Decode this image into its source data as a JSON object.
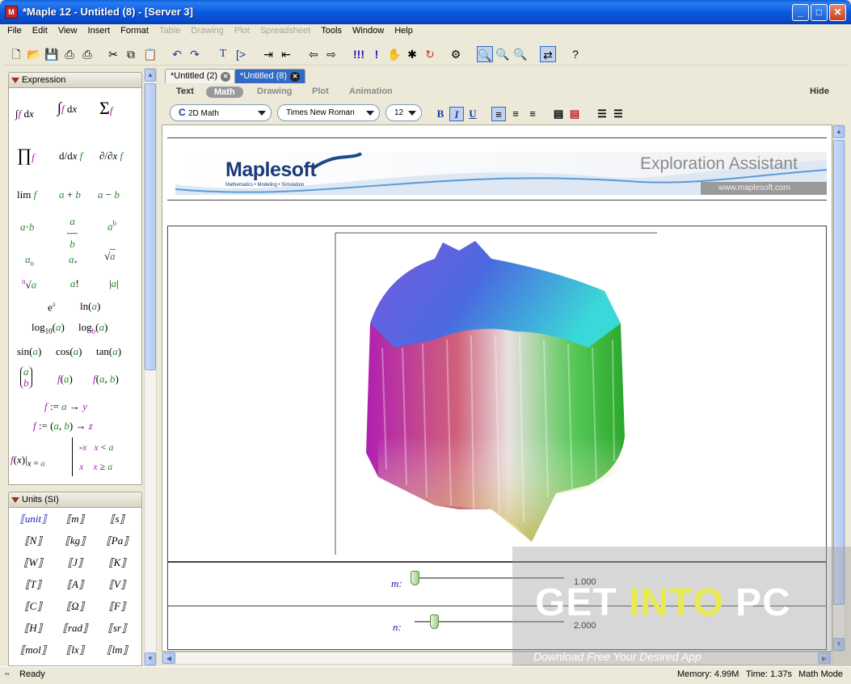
{
  "window": {
    "title": "*Maple 12 - Untitled (8) - [Server 3]",
    "app_icon": "maple-leaf-icon"
  },
  "menu": [
    {
      "label": "File",
      "enabled": true
    },
    {
      "label": "Edit",
      "enabled": true
    },
    {
      "label": "View",
      "enabled": true
    },
    {
      "label": "Insert",
      "enabled": true
    },
    {
      "label": "Format",
      "enabled": true
    },
    {
      "label": "Table",
      "enabled": false
    },
    {
      "label": "Drawing",
      "enabled": false
    },
    {
      "label": "Plot",
      "enabled": false
    },
    {
      "label": "Spreadsheet",
      "enabled": false
    },
    {
      "label": "Tools",
      "enabled": true
    },
    {
      "label": "Window",
      "enabled": true
    },
    {
      "label": "Help",
      "enabled": true
    }
  ],
  "palettes": {
    "expression": {
      "title": "Expression",
      "items": [
        "∫f dx",
        "∫ₐᵇ f dx",
        "Σ f",
        "∏ f",
        "d/dx f",
        "∂/∂x f",
        "lim f",
        "a + b",
        "a − b",
        "a·b",
        "a/b",
        "aᵇ",
        "aₙ",
        "a*",
        "√a",
        "ⁿ√a",
        "a!",
        "|a|",
        "eᵃ",
        "ln(a)",
        "log10(a)",
        "logb(a)",
        "sin(a)",
        "cos(a)",
        "tan(a)",
        "(a b)",
        "f(a)",
        "f(a, b)",
        "f := a → y",
        "f := (a, b) → z",
        "f(x)|x = a",
        "piecewise"
      ]
    },
    "units": {
      "title": "Units (SI)",
      "items": [
        "unit",
        "m",
        "s",
        "N",
        "kg",
        "Pa",
        "W",
        "J",
        "K",
        "T",
        "A",
        "V",
        "C",
        "Ω",
        "F",
        "H",
        "rad",
        "sr",
        "mol",
        "lx",
        "lm"
      ]
    }
  },
  "tabs": [
    {
      "label": "*Untitled (2)",
      "active": false
    },
    {
      "label": "*Untitled (8)",
      "active": true
    }
  ],
  "context": {
    "modes": [
      "Text",
      "Math",
      "Drawing",
      "Plot",
      "Animation"
    ],
    "active_mode": "Math",
    "hide_label": "Hide",
    "math_style": "2D Math",
    "font": "Times New Roman",
    "size": "12",
    "style_buttons": [
      "B",
      "I",
      "U"
    ]
  },
  "banner": {
    "brand": "Maplesoft",
    "tagline": "Mathematics • Modeling • Simulation",
    "heading": "Exploration Assistant",
    "url": "www.maplesoft.com"
  },
  "sliders": [
    {
      "label": "m:",
      "value": "1.000",
      "level": 0.0
    },
    {
      "label": "n:",
      "value": "2.000",
      "level": 0.1
    }
  ],
  "status": {
    "state": "Ready",
    "memory": "Memory: 4.99M",
    "time": "Time: 1.37s",
    "mode": "Math Mode"
  },
  "watermark": {
    "text_get": "GET ",
    "text_into": "INTO ",
    "text_pc": "PC",
    "sub": "Download Free Your Desired App"
  }
}
